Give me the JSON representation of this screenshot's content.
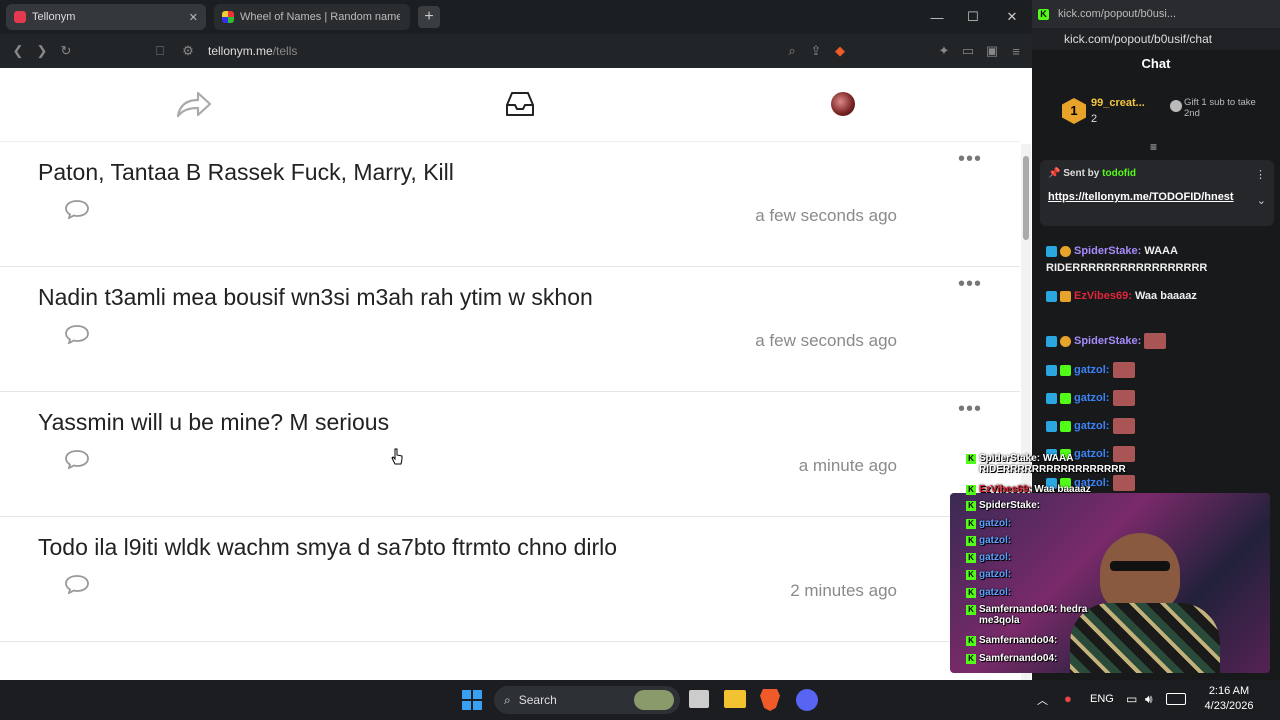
{
  "browser": {
    "tabs": [
      {
        "title": "Tellonym"
      },
      {
        "title": "Wheel of Names | Random name pic"
      }
    ],
    "new_tab": "+",
    "url_domain": "tellonym.me",
    "url_path": "/tells"
  },
  "tells": [
    {
      "text": "Paton, Tantaa B Rassek Fuck, Marry, Kill",
      "time": "a few seconds ago"
    },
    {
      "text": "Nadin t3amli mea bousif wn3si m3ah rah ytim w skhon",
      "time": "a few seconds ago"
    },
    {
      "text": "Yassmin will u be mine? M serious",
      "time": "a minute ago"
    },
    {
      "text": "Todo ila l9iti wldk wachm smya d sa7bto ftrmto chno dirlo",
      "time": "2 minutes ago"
    }
  ],
  "more_label": "•••",
  "chat_window": {
    "title": "kick.com/popout/b0usi...",
    "address": "kick.com/popout/b0usif/chat",
    "header": "Chat",
    "leader": {
      "rank": "1",
      "name": "99_creat...",
      "count": "2",
      "gift_text": "Gift 1 sub to take 2nd"
    },
    "pinned": {
      "sent_by_label": "Sent by",
      "sender": "todofid",
      "link": "https://tellonym.me/TODOFID/hnest"
    },
    "messages": [
      {
        "user": "SpiderStake:",
        "text": "WAAA RIDERRRRRRRRRRRRRRRRR",
        "color": "#a78bfa"
      },
      {
        "user": "EzVibes69:",
        "text": "Waa baaaaz",
        "color": "#e0263a"
      },
      {
        "user": "SpiderStake:",
        "text": "",
        "color": "#a78bfa"
      },
      {
        "user": "gatzol:",
        "text": "",
        "color": "#3b82f6"
      },
      {
        "user": "gatzol:",
        "text": "",
        "color": "#3b82f6"
      },
      {
        "user": "gatzol:",
        "text": "",
        "color": "#3b82f6"
      },
      {
        "user": "gatzol:",
        "text": "",
        "color": "#3b82f6"
      },
      {
        "user": "gatzol:",
        "text": "",
        "color": "#3b82f6"
      }
    ]
  },
  "overlay": {
    "lines": [
      {
        "user": "SpiderStake:",
        "text": "WAAA RIDERRRRRRRRRRRRRRRRR",
        "color": "#ffffff"
      },
      {
        "user": "EzVibes69:",
        "text": "Waa baaaaz",
        "color": "#e0263a"
      },
      {
        "user": "SpiderStake:",
        "text": "",
        "color": "#ffffff"
      },
      {
        "user": "gatzol:",
        "text": "",
        "color": "#5aa0ff"
      },
      {
        "user": "gatzol:",
        "text": "",
        "color": "#5aa0ff"
      },
      {
        "user": "gatzol:",
        "text": "",
        "color": "#5aa0ff"
      },
      {
        "user": "gatzol:",
        "text": "",
        "color": "#5aa0ff"
      },
      {
        "user": "gatzol:",
        "text": "",
        "color": "#5aa0ff"
      },
      {
        "user": "Samfernando04:",
        "text": "hedra me3qola",
        "color": "#ffffff"
      },
      {
        "user": "Samfernando04:",
        "text": "",
        "color": "#ffffff"
      },
      {
        "user": "Samfernando04:",
        "text": "",
        "color": "#ffffff"
      }
    ]
  },
  "taskbar": {
    "search_placeholder": "Search",
    "lang": "ENG",
    "time": "2:16 AM",
    "date": "4/23/2026"
  },
  "colors": {
    "accent_kick": "#53fc18",
    "tellonym_red": "#e53950"
  }
}
